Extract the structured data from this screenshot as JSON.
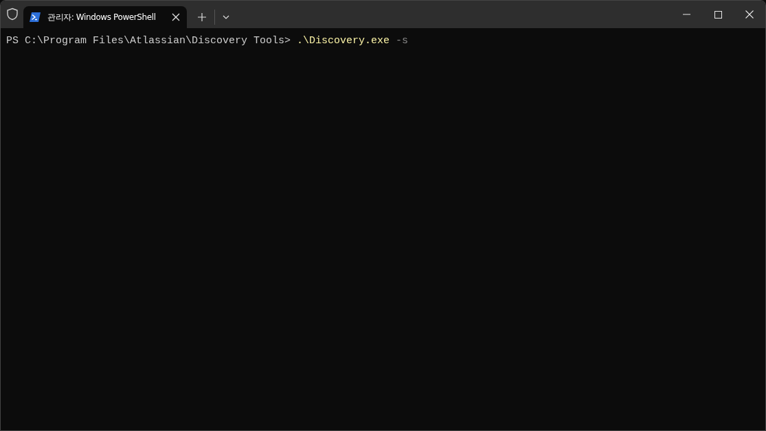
{
  "tabs": [
    {
      "label": "관리자: Windows PowerShell",
      "selected": true
    }
  ],
  "terminal": {
    "lines": [
      {
        "segments": [
          {
            "kind": "prompt",
            "text": "PS C:\\Program Files\\Atlassian\\Discovery Tools> "
          },
          {
            "kind": "command",
            "text": ".\\Discovery.exe"
          },
          {
            "kind": "argument",
            "text": " -s"
          }
        ]
      }
    ]
  }
}
